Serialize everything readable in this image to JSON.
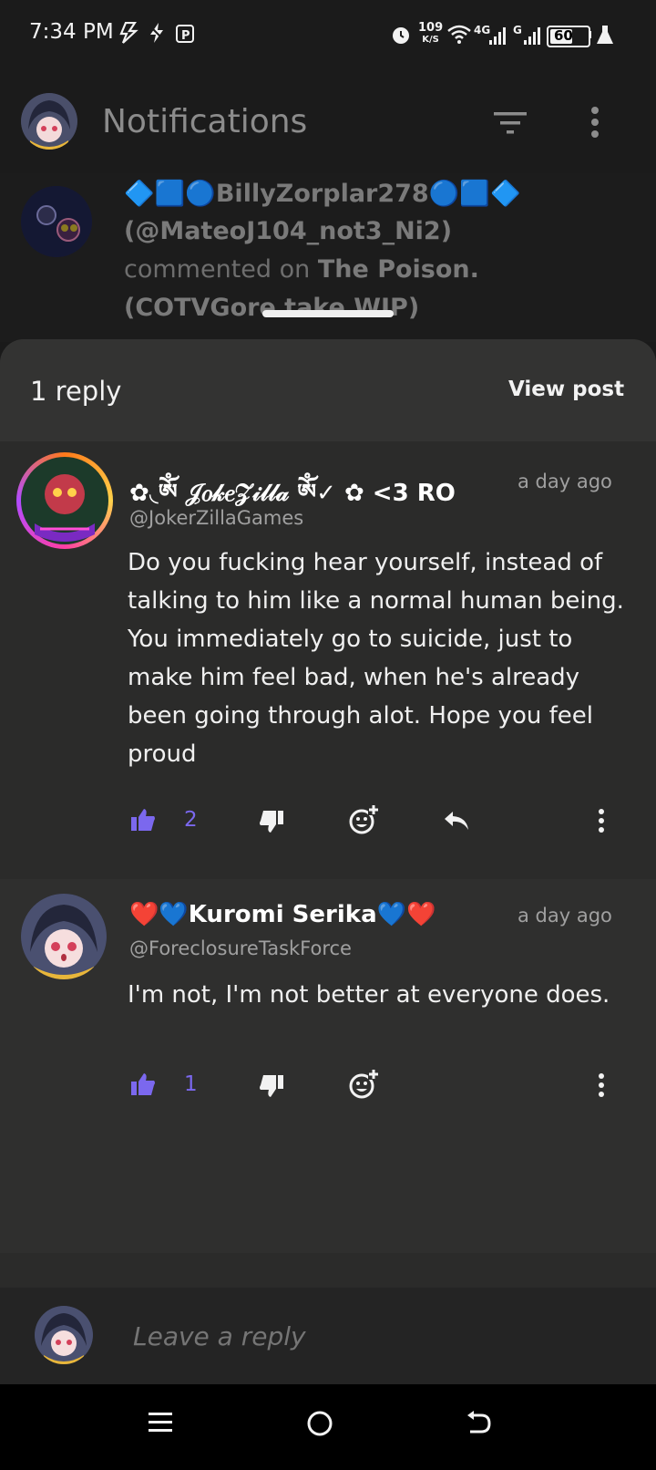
{
  "status_bar": {
    "time": "7:34 PM",
    "net_speed_value": "109",
    "net_speed_unit": "K/S",
    "network_4g": "4G",
    "network_g": "G",
    "battery": "60"
  },
  "header": {
    "title": "Notifications"
  },
  "notification": {
    "name_line": "🔷🟦🔵BillyZorplar278🔵🟦🔷",
    "handle": "(@MateoJ104_not3_Ni2)",
    "action": "commented on",
    "post_title": "The Poison.",
    "post_title_cont": "(COTVGore take WIP)"
  },
  "sheet": {
    "reply_count": "1 reply",
    "view_post": "View post"
  },
  "comments": [
    {
      "name": "✿◟ༀ 𝒥𝑜𝓀𝑒𝒵𝒾𝓁𝓁𝒶 ༀ✓ ✿  <3  RO",
      "time": "a day ago",
      "handle": "@JokerZillaGames",
      "body": "Do you fucking hear yourself, instead of talking to him like a normal human being. You immediately go to suicide, just to make him feel bad, when he's already been going through alot. Hope you feel proud",
      "likes": "2"
    },
    {
      "name": "❤️💙Kuromi Serika💙❤️",
      "time": "a day ago",
      "handle": "@ForeclosureTaskForce",
      "body": "I'm not, I'm not better at everyone does.",
      "likes": "1"
    }
  ],
  "reply_box": {
    "placeholder": "Leave a reply"
  },
  "colors": {
    "accent": "#7b68ee",
    "sheet_bg": "#2b2b2a",
    "header_bg": "#1b1b1b"
  },
  "icons": [
    "flash-icon",
    "bolt-icon",
    "parking-icon",
    "alarm-icon",
    "wifi-icon",
    "signal-icon",
    "battery-icon",
    "flask-icon",
    "filter-icon",
    "more-vert-icon",
    "thumbs-up-icon",
    "thumbs-down-icon",
    "add-reaction-icon",
    "reply-icon",
    "menu-icon",
    "home-icon",
    "back-icon"
  ]
}
